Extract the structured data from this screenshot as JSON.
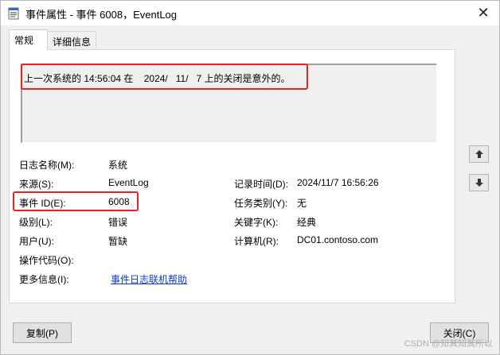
{
  "window": {
    "title": "事件属性 - 事件 6008，EventLog",
    "close_glyph": "✕"
  },
  "tabs": [
    {
      "label": "常规",
      "active": true
    },
    {
      "label": "详细信息",
      "active": false
    }
  ],
  "description": "上一次系统的 14:56:04 在    2024/   11/   7 上的关闭是意外的。",
  "fields": {
    "log_name_label": "日志名称(M):",
    "log_name_value": "系统",
    "source_label": "来源(S):",
    "source_value": "EventLog",
    "logged_label": "记录时间(D):",
    "logged_value": "2024/11/7 16:56:26",
    "event_id_label": "事件 ID(E):",
    "event_id_value": "6008",
    "task_category_label": "任务类别(Y):",
    "task_category_value": "无",
    "level_label": "级别(L):",
    "level_value": "错误",
    "keywords_label": "关键字(K):",
    "keywords_value": "经典",
    "user_label": "用户(U):",
    "user_value": "暂缺",
    "computer_label": "计算机(R):",
    "computer_value": "DC01.contoso.com",
    "opcode_label": "操作代码(O):",
    "more_info_label": "更多信息(I):",
    "more_info_link": "事件日志联机帮助"
  },
  "buttons": {
    "copy": "复制(P)",
    "close": "关闭(C)"
  },
  "watermark": "CSDN @知其知其所以",
  "colors": {
    "highlight": "#e8231c",
    "link": "#0f37ce"
  }
}
